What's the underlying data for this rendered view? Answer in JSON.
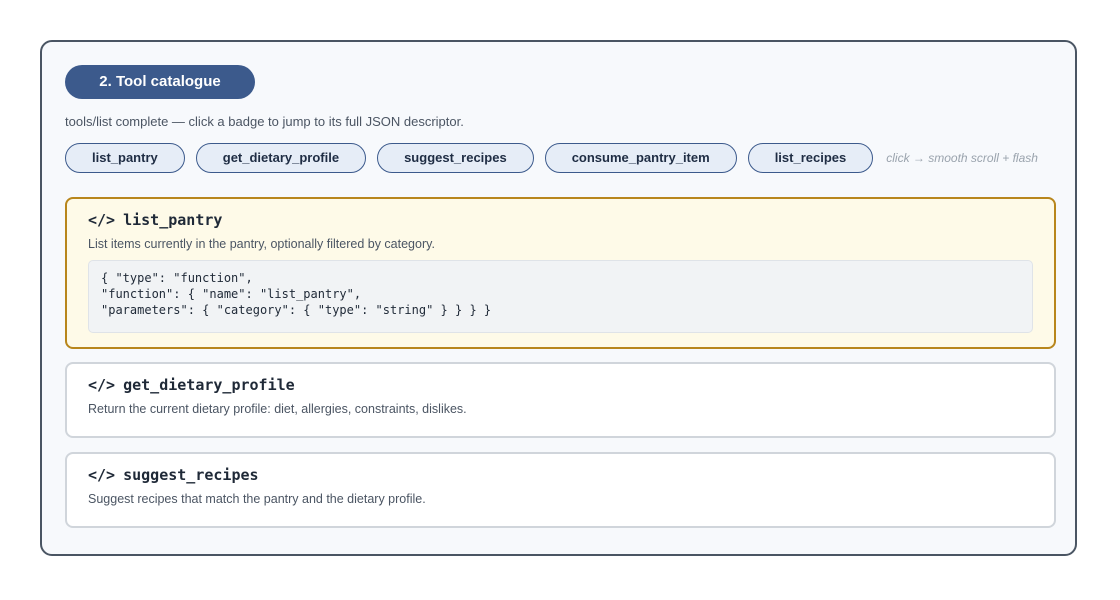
{
  "section": {
    "step_label": "2. Tool catalogue",
    "intro": "tools/list complete — click a badge to jump to its full JSON descriptor."
  },
  "badges": [
    {
      "label": "list_pantry"
    },
    {
      "label": "get_dietary_profile"
    },
    {
      "label": "suggest_recipes"
    },
    {
      "label": "consume_pantry_item"
    },
    {
      "label": "list_recipes"
    }
  ],
  "hint": "click → smooth scroll + flash",
  "cards": [
    {
      "code_icon": "</>",
      "name": "list_pantry",
      "description": "List items currently in the pantry, optionally filtered by category.",
      "json_lines": [
        "{ \"type\": \"function\",",
        "\"function\": { \"name\": \"list_pantry\",",
        "\"parameters\": { \"category\": { \"type\": \"string\" } } } }"
      ],
      "highlighted": true
    },
    {
      "code_icon": "</>",
      "name": "get_dietary_profile",
      "description": "Return the current dietary profile: diet, allergies, constraints, dislikes."
    },
    {
      "code_icon": "</>",
      "name": "suggest_recipes",
      "description": "Suggest recipes that match the pantry and the dietary profile."
    }
  ],
  "colors": {
    "accent": "#3c5a8c",
    "highlight_border": "#b8861c",
    "highlight_bg": "#fefae8"
  }
}
